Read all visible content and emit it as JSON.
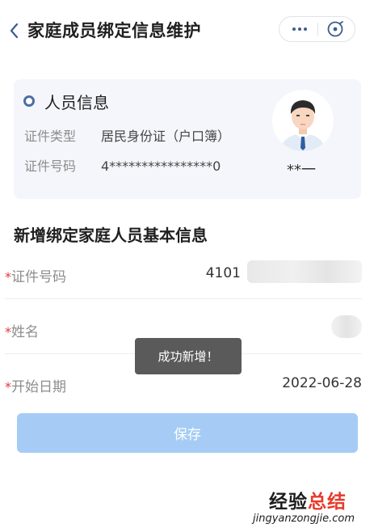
{
  "header": {
    "title": "家庭成员绑定信息维护",
    "back_icon": "chevron-left-icon",
    "more_icon": "more-dots-icon",
    "close_icon": "target-close-icon"
  },
  "person_card": {
    "section_title": "人员信息",
    "id_type_label": "证件类型",
    "id_type_value": "居民身份证（户口簿）",
    "id_number_label": "证件号码",
    "id_number_value": "4****************0",
    "name_masked": "**一"
  },
  "form": {
    "title": "新增绑定家庭人员基本信息",
    "required_mark": "*",
    "fields": [
      {
        "label": "证件号码",
        "value": "4101"
      },
      {
        "label": "姓名",
        "value": ""
      },
      {
        "label": "开始日期",
        "value": "2022-06-28"
      }
    ]
  },
  "toast": {
    "text": "成功新增！"
  },
  "save_button": {
    "label": "保存"
  },
  "watermark": {
    "prefix": "经验",
    "highlight": "总结",
    "url": "jingyanzongjie.com"
  },
  "colors": {
    "accent": "#4c6ea0",
    "save_button": "#a6ccf5",
    "required": "#e0393e",
    "toast_bg": "#5a5a5a"
  }
}
